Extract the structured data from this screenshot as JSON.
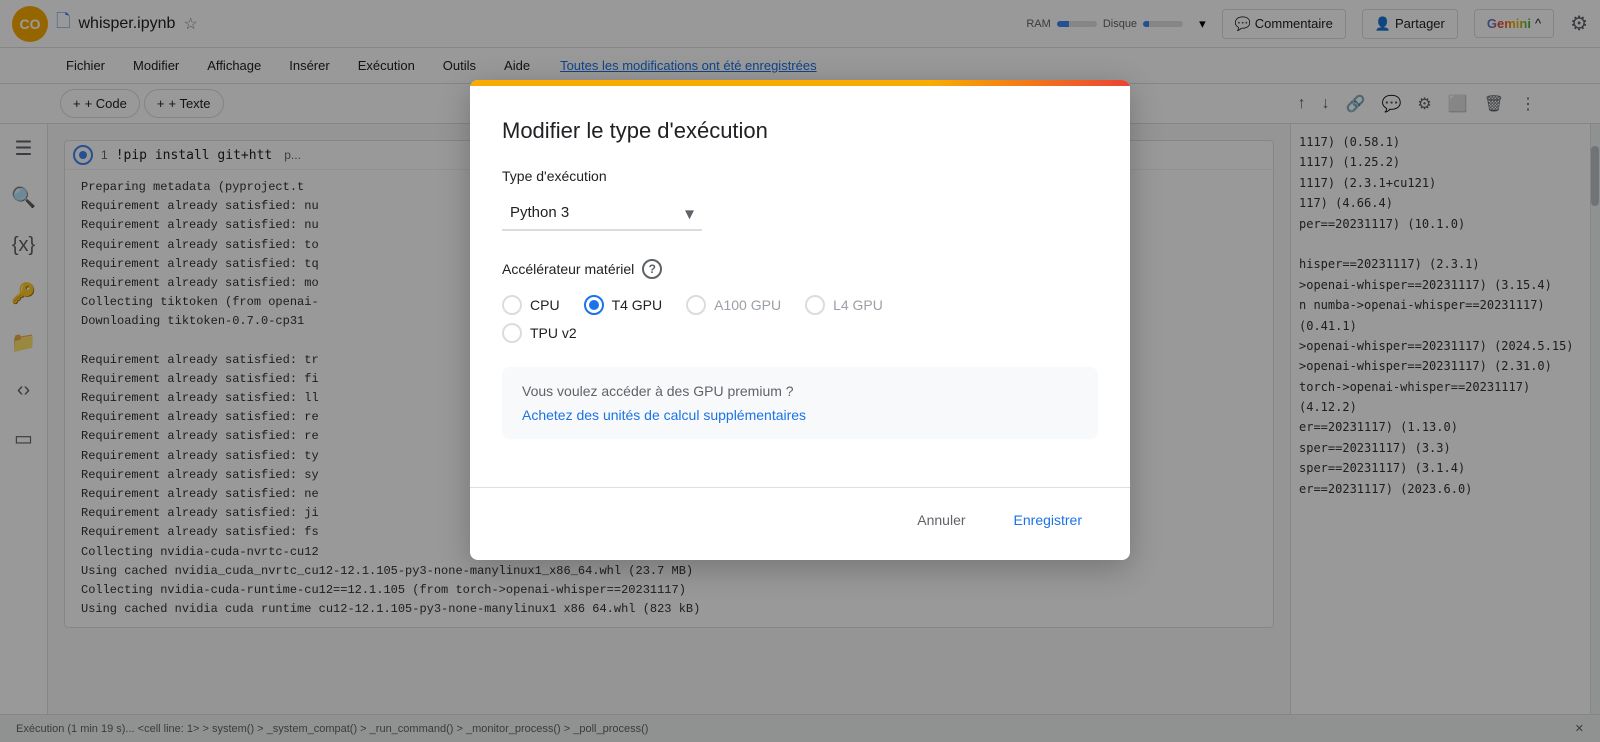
{
  "topbar": {
    "logo": "CO",
    "doc_icon": "📄",
    "filename": "whisper.ipynb",
    "star_icon": "☆",
    "comment_label": "Commentaire",
    "share_label": "Partager",
    "ram_label": "RAM",
    "disk_label": "Disque",
    "gemini_label": "Gemini",
    "chevron_up": "⌃",
    "chevron_down": "⌄"
  },
  "menubar": {
    "items": [
      "Fichier",
      "Modifier",
      "Affichage",
      "Insérer",
      "Exécution",
      "Outils",
      "Aide"
    ],
    "saved_text": "Toutes les modifications ont été enregistrées"
  },
  "toolbar": {
    "add_code_label": "+ Code",
    "add_text_label": "+ Texte"
  },
  "cell": {
    "number": "1",
    "code": "!pip install git+htt",
    "output_lines": [
      "  Preparing metadata (pyproject.t",
      "Requirement already satisfied: nu",
      "Requirement already satisfied: nu",
      "Requirement already satisfied: to",
      "Requirement already satisfied: tq",
      "Requirement already satisfied: mo",
      "Collecting tiktoken (from openai-",
      "  Downloading tiktoken-0.7.0-cp31",
      "",
      "Requirement already satisfied: tr",
      "Requirement already satisfied: fi",
      "Requirement already satisfied: ll",
      "Requirement already satisfied: re",
      "Requirement already satisfied: re",
      "Requirement already satisfied: ty",
      "Requirement already satisfied: sy",
      "Requirement already satisfied: ne",
      "Requirement already satisfied: ji",
      "Requirement already satisfied: fs",
      "Collecting nvidia-cuda-nvrtc-cu12",
      "  Using cached nvidia_cuda_nvrtc_cu12-12.1.105-py3-none-manylinux1_x86_64.whl (23.7 MB)",
      "Collecting nvidia-cuda-runtime-cu12==12.1.105 (from torch->openai-whisper==20231117)",
      "  Using cached nvidia cuda runtime cu12-12.1.105-py3-none-manylinux1 x86 64.whl (823 kB)"
    ]
  },
  "right_output_lines": [
    "1117) (0.58.1)",
    "1117) (1.25.2)",
    "1117) (2.3.1+cu121)",
    "117) (4.66.4)",
    "per==20231117) (10.1.0)",
    "hisper==20231117) (2.3.1)",
    ">openai-whisper==20231117) (3.15.4)",
    "n numba->openai-whisper==20231117) (0.41.1)",
    ">openai-whisper==20231117) (2024.5.15)",
    ">openai-whisper==20231117) (2.31.0)",
    "torch->openai-whisper==20231117) (4.12.2)",
    "er==20231117) (1.13.0)",
    "sper==20231117) (3.3)",
    "sper==20231117) (3.1.4)",
    "er==20231117) (2023.6.0)"
  ],
  "statusbar": {
    "text": "Exécution (1 min 19 s)... <cell line: 1> > system() > _system_compat() > _run_command() > _monitor_process() > _poll_process()"
  },
  "modal": {
    "title": "Modifier le type d'exécution",
    "runtime_label": "Type d'exécution",
    "runtime_option": "Python 3",
    "accelerator_label": "Accélérateur matériel",
    "options": [
      {
        "id": "cpu",
        "label": "CPU",
        "selected": false,
        "disabled": false
      },
      {
        "id": "t4gpu",
        "label": "T4 GPU",
        "selected": true,
        "disabled": false
      },
      {
        "id": "a100gpu",
        "label": "A100 GPU",
        "selected": false,
        "disabled": true
      },
      {
        "id": "l4gpu",
        "label": "L4 GPU",
        "selected": false,
        "disabled": true
      },
      {
        "id": "tpuv2",
        "label": "TPU v2",
        "selected": false,
        "disabled": false
      }
    ],
    "premium_text": "Vous voulez accéder à des GPU premium ?",
    "premium_link": "Achetez des unités de calcul supplémentaires",
    "cancel_label": "Annuler",
    "save_label": "Enregistrer"
  }
}
